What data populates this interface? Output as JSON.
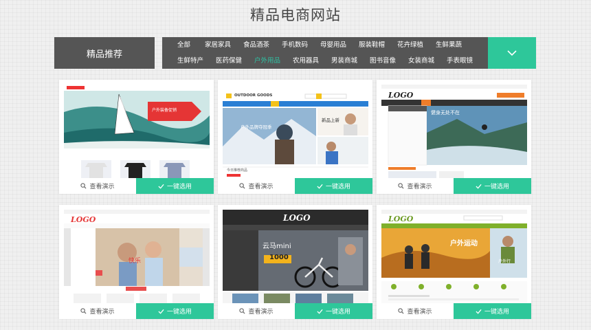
{
  "page": {
    "title": "精品电商网站"
  },
  "categories": {
    "recommend_label": "精品推荐",
    "row1": [
      "全部",
      "家居家具",
      "食品酒茶",
      "手机数码",
      "母婴用品",
      "服装鞋帽",
      "花卉绿植",
      "生鲜果蔬"
    ],
    "row2": [
      "生鲜特产",
      "医药保健",
      "户外用品",
      "农用器具",
      "男装商城",
      "图书音像",
      "女装商城",
      "手表眼镜"
    ],
    "active": "户外用品",
    "expand_icon": "chevron-down-icon"
  },
  "card_actions": {
    "demo_label": "查看演示",
    "select_label": "一键选用",
    "demo_icon": "search-icon",
    "select_icon": "check-icon"
  },
  "thumbs": {
    "t1": {
      "banner": "户外装备促销"
    },
    "t2": {
      "brand": "OUTDOOR GOODS",
      "hero": "户外品牌夺冠季",
      "side1": "新品上新",
      "section": "今日推荐商品"
    },
    "t3": {
      "logo": "LOGO",
      "hero": "健身无处不在"
    },
    "t4": {
      "logo": "LOGO",
      "hero": "快乐"
    },
    "t5": {
      "logo": "LOGO",
      "hero_top": "云马mini",
      "hero_price": "1000"
    },
    "t6": {
      "logo": "LOGO",
      "hero": "户外运动",
      "side": "户外行"
    }
  },
  "colors": {
    "accent": "#2ec79a",
    "active_cat": "#2ec3a4",
    "bar": "#555555"
  }
}
